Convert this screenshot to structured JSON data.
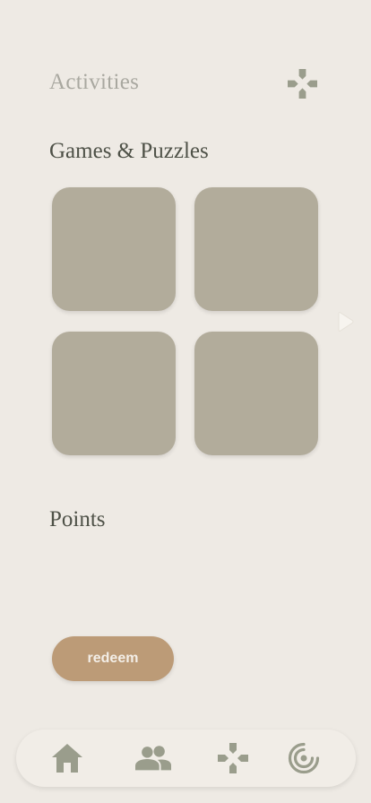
{
  "header": {
    "title": "Activities",
    "icon": "gamepad-icon"
  },
  "games_section": {
    "title": "Games & Puzzles",
    "tiles": [
      "",
      "",
      "",
      ""
    ]
  },
  "points_section": {
    "title": "Points",
    "redeem_label": "redeem"
  },
  "bottom_nav": {
    "items": [
      {
        "icon": "home-icon"
      },
      {
        "icon": "people-icon"
      },
      {
        "icon": "gamepad-icon"
      },
      {
        "icon": "target-icon"
      }
    ]
  },
  "colors": {
    "background": "#eeeae4",
    "tile": "#b2ac9b",
    "accent": "#bc9b77",
    "icon": "#9a9d8c",
    "heading": "#4e5147",
    "muted_heading": "#a9a8a0"
  }
}
